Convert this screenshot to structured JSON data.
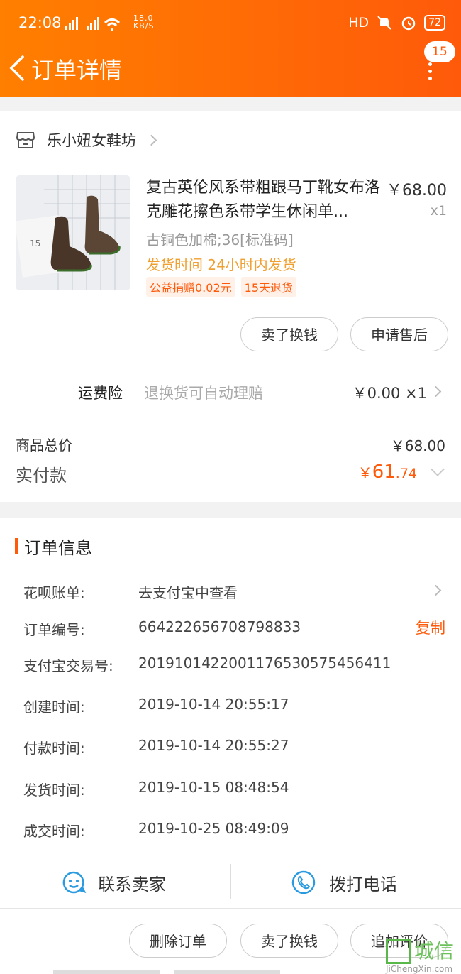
{
  "status_bar": {
    "time": "22:08",
    "signal": "2G 4G",
    "net_speed": "18.0 KB/S",
    "hd": "HD",
    "battery": "72"
  },
  "header": {
    "title": "订单详情",
    "badge": "15"
  },
  "shop": {
    "name": "乐小妞女鞋坊"
  },
  "product": {
    "title": "复古英伦风系带粗跟马丁靴女布洛克雕花擦色系带学生休闲单...",
    "price": "￥68.00",
    "qty": "x1",
    "sku": "古铜色加棉;36[标准码]",
    "ship": "发货时间 24小时内发货",
    "tags": [
      "公益捐赠0.02元",
      "15天退货"
    ],
    "thumb_label": "15"
  },
  "item_actions": {
    "sell_exchange": "卖了换钱",
    "after_sale": "申请售后"
  },
  "insurance": {
    "label": "运费险",
    "desc": "退换货可自动理赔",
    "value": "￥0.00 ×1"
  },
  "totals": {
    "goods_total_label": "商品总价",
    "goods_total_value": "￥68.00",
    "paid_label": "实付款",
    "paid_symbol": "￥",
    "paid_int": "61",
    "paid_dec": ".74"
  },
  "order_info": {
    "section_title": "订单信息",
    "rows": [
      {
        "key": "花呗账单:",
        "value": "去支付宝中查看"
      },
      {
        "key": "订单编号:",
        "value": "664222656708798833"
      },
      {
        "key": "支付宝交易号:",
        "value": "2019101422001176530575456411"
      },
      {
        "key": "创建时间:",
        "value": "2019-10-14 20:55:17"
      },
      {
        "key": "付款时间:",
        "value": "2019-10-14 20:55:27"
      },
      {
        "key": "发货时间:",
        "value": "2019-10-15 08:48:54"
      },
      {
        "key": "成交时间:",
        "value": "2019-10-25 08:49:09"
      }
    ],
    "copy_label": "复制"
  },
  "contact": {
    "seller": "联系卖家",
    "call": "拨打电话"
  },
  "bottom_actions": {
    "delete": "删除订单",
    "sell_exchange": "卖了换钱",
    "add_review": "追加评价"
  },
  "watermark": {
    "text": "城信",
    "url": "JiChengXin.com"
  },
  "colors": {
    "accent": "#ff5a0a",
    "header_start": "#ff7f00",
    "icon_blue": "#2a9be0"
  }
}
